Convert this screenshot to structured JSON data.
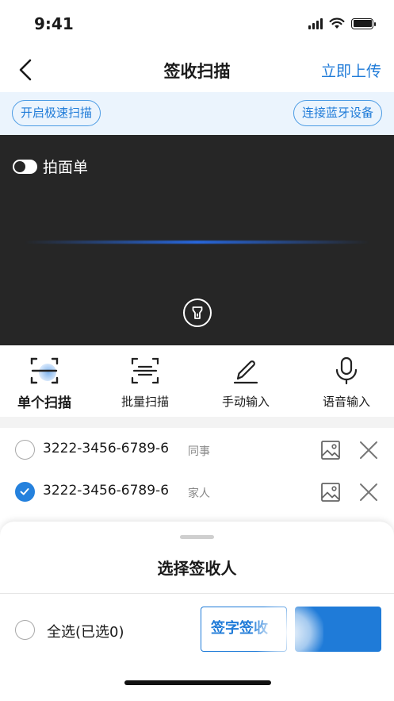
{
  "status_bar": {
    "time": "9:41"
  },
  "nav": {
    "title": "签收扫描",
    "upload_label": "立即上传"
  },
  "toolbar": {
    "speed_scan_label": "开启极速扫描",
    "bluetooth_label": "连接蓝牙设备"
  },
  "camera": {
    "photo_toggle_label": "拍面单",
    "photo_toggle_on": false
  },
  "modes": [
    {
      "label": "单个扫描",
      "icon": "single-scan-icon",
      "active": true
    },
    {
      "label": "批量扫描",
      "icon": "batch-scan-icon",
      "active": false
    },
    {
      "label": "手动输入",
      "icon": "pen-icon",
      "active": false
    },
    {
      "label": "语音输入",
      "icon": "microphone-icon",
      "active": false
    }
  ],
  "items": [
    {
      "code": "3222-3456-6789-6",
      "tag": "同事",
      "checked": false
    },
    {
      "code": "3222-3456-6789-6",
      "tag": "家人",
      "checked": true
    }
  ],
  "sheet": {
    "title": "选择签收人",
    "select_all_label": "全选(已选0)",
    "sign_label": "签字签收",
    "confirm_label": ""
  },
  "colors": {
    "accent": "#1f7bd8",
    "camera_bg": "#262626",
    "toolbar_bg": "#ebf4fd"
  }
}
